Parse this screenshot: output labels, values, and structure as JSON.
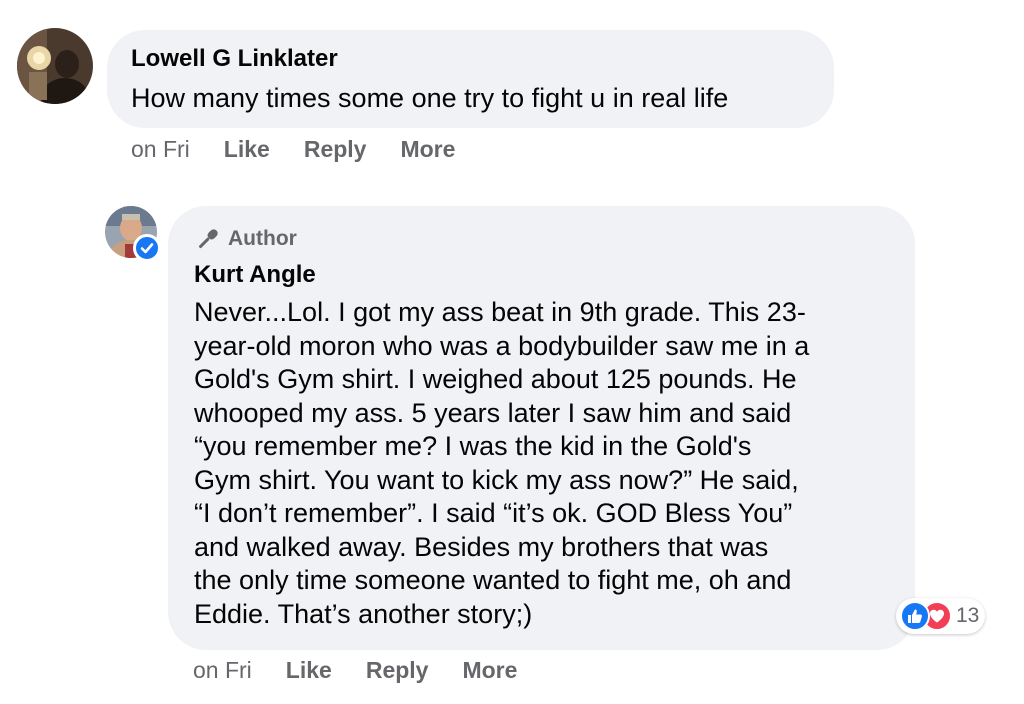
{
  "comments": [
    {
      "author": "Lowell G Linklater",
      "text_lines": [
        "How many times some one try to fight u in real life"
      ],
      "actions": {
        "time": "on Fri",
        "like": "Like",
        "reply": "Reply",
        "more": "More"
      }
    },
    {
      "badge": "Author",
      "author": "Kurt Angle",
      "verified": true,
      "text_lines": [
        "Never...Lol. I got my ass beat in 9th grade. This 23-",
        "year-old moron who was a bodybuilder saw me in a",
        "Gold's Gym shirt. I weighed about 125 pounds. He",
        "whooped my ass. 5 years later I saw him and said",
        "“you remember me? I was the kid in the Gold's",
        "Gym shirt. You want to kick my ass now?” He said,",
        "“I don’t remember”. I said “it’s ok. GOD Bless You”",
        "and walked away. Besides my brothers that was",
        "the only time someone wanted to fight me, oh and",
        "Eddie. That’s another story;)"
      ],
      "reactions": {
        "icons": [
          "like-icon",
          "love-icon"
        ],
        "count": "13"
      },
      "actions": {
        "time": "on Fri",
        "like": "Like",
        "reply": "Reply",
        "more": "More"
      }
    }
  ],
  "colors": {
    "bubble": "#f0f2f5",
    "meta_text": "#65676b",
    "like_blue": "#1877f2",
    "love_red": "#f33e58"
  }
}
